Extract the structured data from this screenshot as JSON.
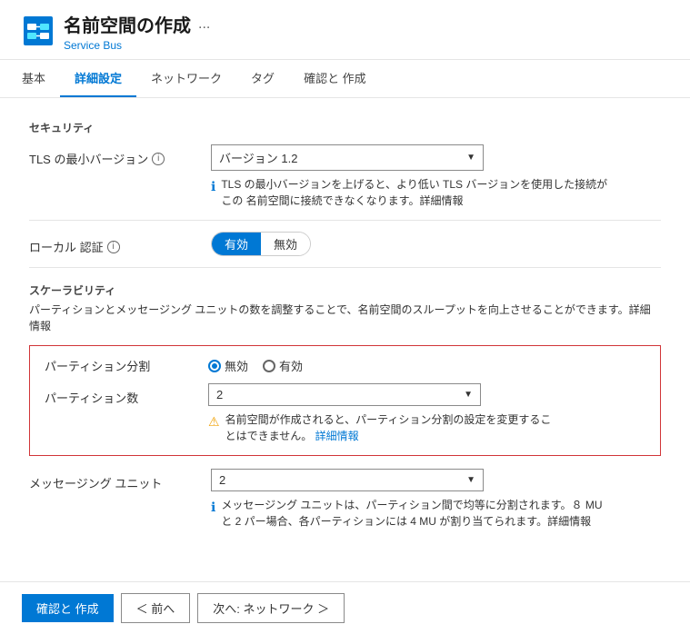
{
  "header": {
    "title": "名前空間の作成",
    "subtitle": "Service Bus",
    "more_label": "..."
  },
  "tabs": [
    {
      "id": "basics",
      "label": "基本",
      "active": false
    },
    {
      "id": "advanced",
      "label": "詳細設定",
      "active": true
    },
    {
      "id": "network",
      "label": "ネットワーク",
      "active": false
    },
    {
      "id": "tags",
      "label": "タグ",
      "active": false
    },
    {
      "id": "review",
      "label": "確認と 作成",
      "active": false
    }
  ],
  "security": {
    "section_label": "セキュリティ",
    "tls_label": "TLS の最小バージョン",
    "tls_value": "バージョン 1.2",
    "tls_info_text": "TLS の最小バージョンを上げると、より低い TLS バージョンを使用した接続がこの 名前空間に接続できなくなります。詳細情報"
  },
  "local_auth": {
    "label": "ローカル 認証",
    "toggle_on": "有効",
    "toggle_off": "無効",
    "active": "on"
  },
  "scalability": {
    "section_label": "スケーラビリティ",
    "description": "パーティションとメッセージング ユニットの数を調整することで、名前空間のスループットを向上させることができます。詳細情報"
  },
  "partition": {
    "label": "パーティション分割",
    "radio_disabled": "無効",
    "radio_enabled": "有効",
    "selected": "disabled",
    "count_label": "パーティション数",
    "count_value": "2",
    "warning_text": "名前空間が作成されると、パーティション分割の設定を変更することはできません。",
    "warning_link": "詳細情報"
  },
  "messaging": {
    "label": "メッセージング ユニット",
    "value": "2",
    "info_text": "メッセージング ユニットは、パーティション間で均等に分割されます。８ MU と 2 パー場合、各パーティションには 4 MU が割り当てられます。詳細情報"
  },
  "footer": {
    "confirm_label": "確認と 作成",
    "back_label": "＜ 前へ",
    "next_label": "次へ: ネットワーク ＞"
  }
}
